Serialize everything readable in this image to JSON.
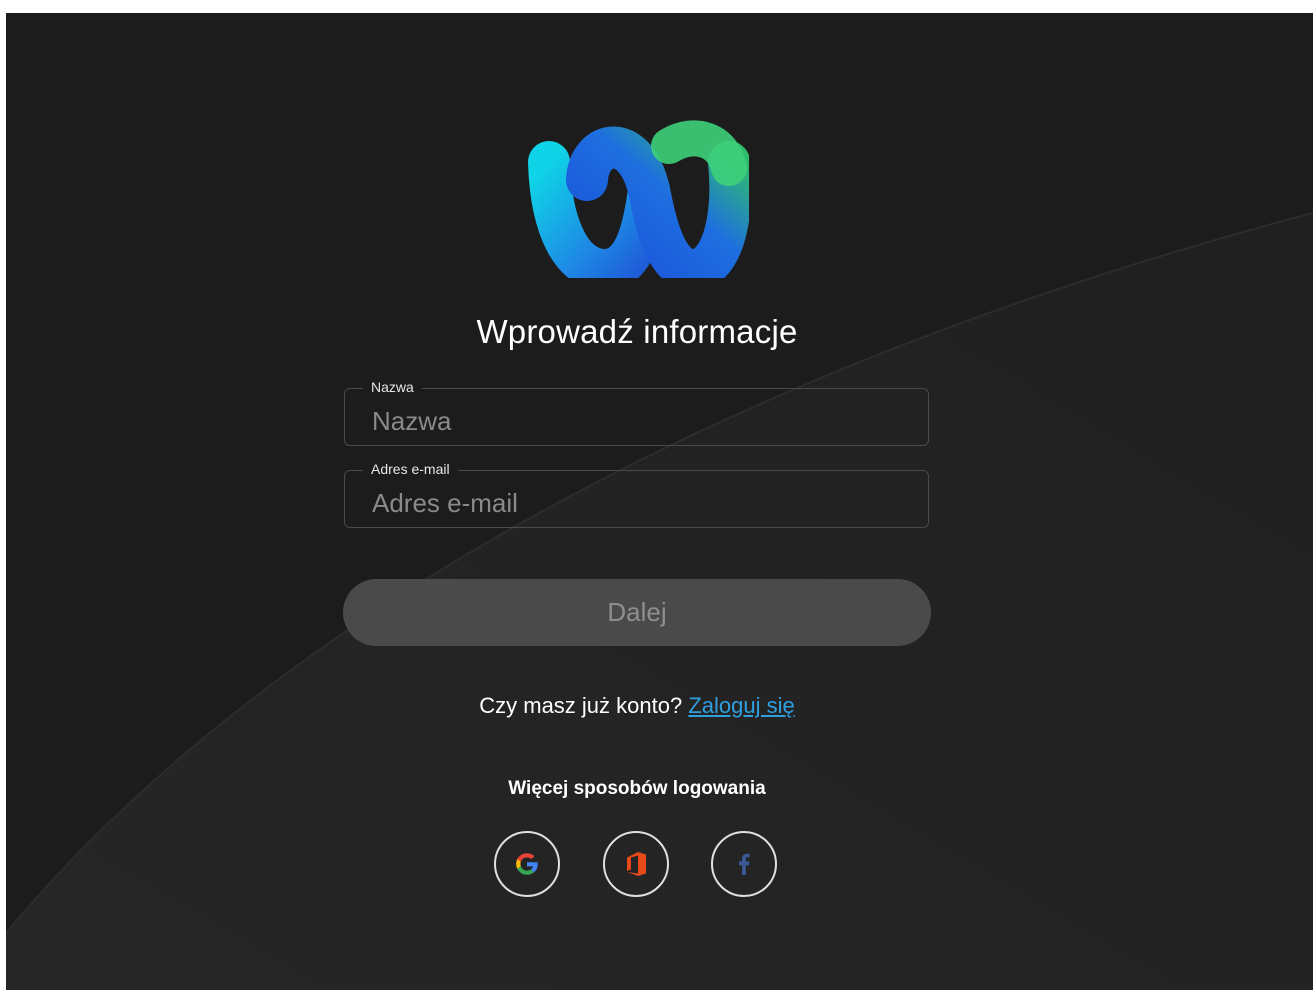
{
  "title": "Wprowadź informacje",
  "form": {
    "name_label": "Nazwa",
    "name_placeholder": "Nazwa",
    "name_value": "",
    "email_label": "Adres e-mail",
    "email_placeholder": "Adres e-mail",
    "email_value": ""
  },
  "next_button": "Dalej",
  "account": {
    "question": "Czy masz już konto?",
    "login_link": "Zaloguj się"
  },
  "more_ways": "Więcej sposobów logowania",
  "social_buttons": [
    {
      "icon": "google-icon"
    },
    {
      "icon": "office-icon"
    },
    {
      "icon": "facebook-icon"
    }
  ],
  "colors": {
    "background": "#1c1c1c",
    "link": "#2f9fe0",
    "button_disabled": "#4a4a4a",
    "office_red": "#e64a19",
    "facebook_blue": "#3b5998"
  }
}
